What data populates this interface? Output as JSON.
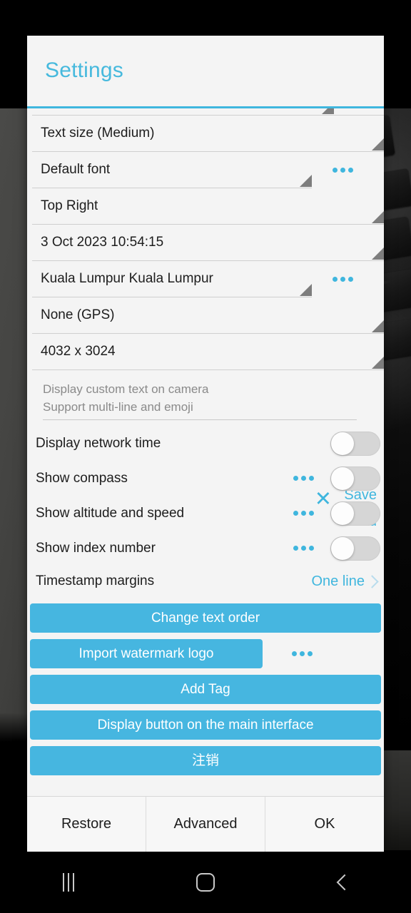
{
  "dialog": {
    "title": "Settings",
    "spinners": [
      {
        "label": "Text size (Medium)",
        "has_more": false
      },
      {
        "label": "Default font",
        "has_more": true
      },
      {
        "label": "Top Right",
        "has_more": false
      },
      {
        "label": "3 Oct 2023 10:54:15",
        "has_more": false
      },
      {
        "label": "Kuala Lumpur Kuala Lumpur",
        "has_more": true
      },
      {
        "label": "None (GPS)",
        "has_more": false
      },
      {
        "label": "4032 x 3024",
        "has_more": false
      }
    ],
    "custom_text": {
      "value": "",
      "placeholder_line1": "Display custom text on camera",
      "placeholder_line2": "Support multi-line and emoji",
      "clear_icon": "close-icon",
      "save_label": "Save",
      "load_label": "Load"
    },
    "toggles": [
      {
        "label": "Display network time",
        "state": "off",
        "has_more": false
      },
      {
        "label": "Show compass",
        "state": "off",
        "has_more": true
      },
      {
        "label": "Show altitude and speed",
        "state": "off",
        "has_more": true
      },
      {
        "label": "Show index number",
        "state": "off",
        "has_more": true
      }
    ],
    "margins": {
      "label": "Timestamp margins",
      "value": "One line",
      "chevron_icon": "chevron-right-icon"
    },
    "actions": [
      {
        "label": "Change text order",
        "has_more": false,
        "partial_width": false
      },
      {
        "label": "Import watermark logo",
        "has_more": true,
        "partial_width": true
      },
      {
        "label": "Add Tag",
        "has_more": false,
        "partial_width": false
      },
      {
        "label": "Display button on the main interface",
        "has_more": false,
        "partial_width": false
      },
      {
        "label": "注销",
        "has_more": false,
        "partial_width": false
      }
    ],
    "footer": {
      "restore_label": "Restore",
      "advanced_label": "Advanced",
      "ok_label": "OK"
    }
  },
  "navbar": {
    "recents_icon": "recents-icon",
    "home_icon": "home-icon",
    "back_icon": "back-icon"
  },
  "colors": {
    "accent": "#3fb6de",
    "button": "#46b6e0",
    "dialog_bg": "#f4f4f4",
    "text": "#1d1d1d"
  }
}
